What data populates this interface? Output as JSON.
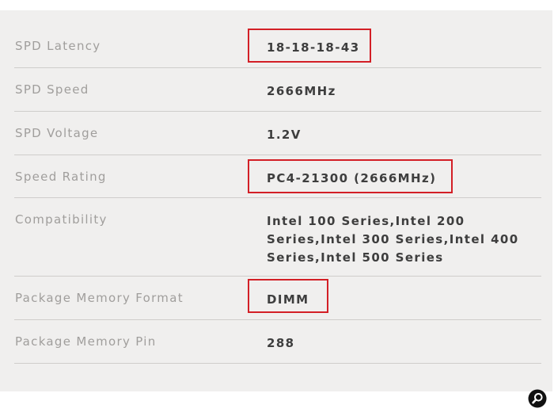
{
  "specs": [
    {
      "label": "SPD Latency",
      "value": "18-18-18-43"
    },
    {
      "label": "SPD Speed",
      "value": "2666MHz"
    },
    {
      "label": "SPD Voltage",
      "value": "1.2V"
    },
    {
      "label": "Speed Rating",
      "value": "PC4-21300 (2666MHz)"
    },
    {
      "label": "Compatibility",
      "value": "Intel 100 Series,Intel 200 Series,Intel 300 Series,Intel 400 Series,Intel 500 Series"
    },
    {
      "label": "Package Memory Format",
      "value": "DIMM"
    },
    {
      "label": "Package Memory Pin",
      "value": "288"
    }
  ],
  "highlighted_values": [
    "18-18-18-43",
    "PC4-21300 (2666MHz)",
    "DIMM"
  ],
  "colors": {
    "panel_background": "#f0efee",
    "label_text": "#a09e9c",
    "value_text": "#3e3e3e",
    "divider": "#cfcdcb",
    "highlight_border": "#d31f26"
  },
  "icons": {
    "zoom": "zoom-icon"
  }
}
